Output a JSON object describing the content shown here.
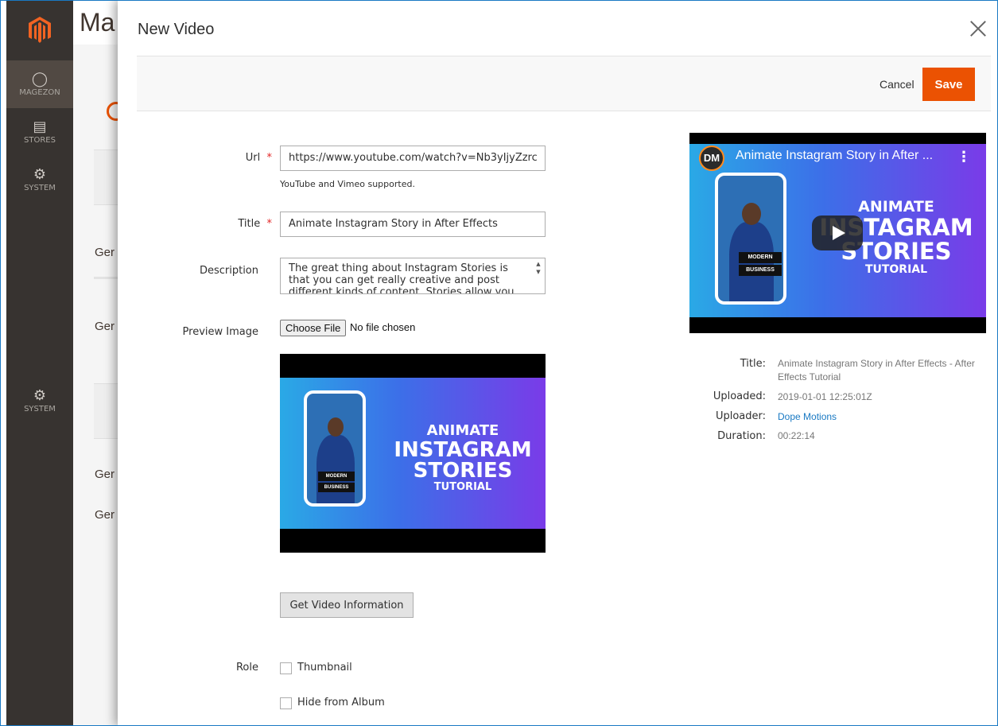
{
  "background": {
    "title_fragment": "Ma",
    "section_fragments": [
      "Ger",
      "Ger",
      "Ger",
      "Ger"
    ]
  },
  "sidebar": {
    "items": [
      {
        "label": "MAGEZON",
        "icon": "magezon-icon"
      },
      {
        "label": "STORES",
        "icon": "stores-icon"
      },
      {
        "label": "SYSTEM",
        "icon": "gear-icon"
      },
      {
        "label": "SYSTEM",
        "icon": "gear-icon"
      }
    ]
  },
  "modal": {
    "title": "New Video",
    "cancel_label": "Cancel",
    "save_label": "Save"
  },
  "form": {
    "url_label": "Url",
    "url_value": "https://www.youtube.com/watch?v=Nb3yIjyZzrc",
    "url_note": "YouTube and Vimeo supported.",
    "title_label": "Title",
    "title_value": "Animate Instagram Story in After Effects",
    "description_label": "Description",
    "description_value": "The great thing about Instagram Stories is that you can get really creative and post different kinds of content. Stories allow you to enhance",
    "preview_label": "Preview Image",
    "choose_file_label": "Choose File",
    "no_file_text": "No file chosen",
    "get_info_label": "Get Video Information",
    "role_label": "Role",
    "role_options": [
      "Thumbnail",
      "Hide from Album"
    ]
  },
  "thumbnail": {
    "line1": "ANIMATE",
    "line2": "INSTAGRAM",
    "line3": "STORIES",
    "line4": "TUTORIAL",
    "tag1": "MODERN",
    "tag2": "BUSINESS"
  },
  "player": {
    "channel_badge": "DM",
    "video_title": "Animate Instagram Story in After ...",
    "menu_icon": "more-vertical-icon"
  },
  "video_info": {
    "title_label": "Title:",
    "title_value": "Animate Instagram Story in After Effects - After Effects Tutorial",
    "uploaded_label": "Uploaded:",
    "uploaded_value": "2019-01-01 12:25:01Z",
    "uploader_label": "Uploader:",
    "uploader_value": "Dope Motions",
    "duration_label": "Duration:",
    "duration_value": "00:22:14"
  },
  "colors": {
    "accent": "#eb5202",
    "link": "#1979c3",
    "sidebar": "#373330"
  }
}
